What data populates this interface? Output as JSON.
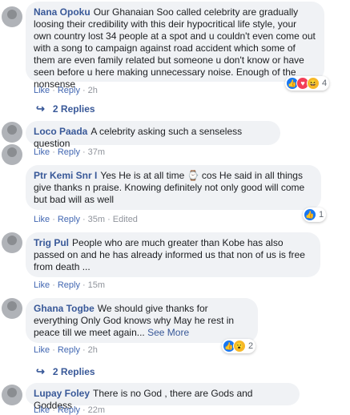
{
  "comments": [
    {
      "author": "Nana Opoku",
      "text": "Our Ghanaian Soo called celebrity are gradually loosing their credibility with this deir hypocritical life style, your own country lost 34 people at a spot and u couldn't even come out with a song to campaign against road accident which some of them are even family related but someone u don't know or have seen before u here making unnecessary noise. Enough of the nonsense",
      "like": "Like",
      "reply": "Reply",
      "time": "2h",
      "reaction_count": "4",
      "reaction_icons": [
        "like-icon",
        "love-icon",
        "haha-icon"
      ],
      "replies": "2 Replies"
    },
    {
      "author": "Loco Paada",
      "text": "A celebrity asking such a senseless question",
      "like": "Like",
      "reply": "Reply",
      "time": "37m"
    },
    {
      "author": "Ptr Kemi Snr I",
      "text": "Yes He is at all time ⌚ cos He said in all things give thanks n praise. Knowing definitely not only good will come but bad will as well",
      "like": "Like",
      "reply": "Reply",
      "time": "35m",
      "edited": "Edited",
      "reaction_count": "1",
      "reaction_icons": [
        "like-icon"
      ]
    },
    {
      "author": "Trig Pul",
      "text": "People who are much greater than Kobe has also passed on and he has already informed us that non of us is free from death ...",
      "like": "Like",
      "reply": "Reply",
      "time": "15m"
    },
    {
      "author": "Ghana Togbe",
      "text": "We should give thanks for everything Only God knows why May he rest in peace till we meet again...",
      "see_more": "See More",
      "like": "Like",
      "reply": "Reply",
      "time": "2h",
      "reaction_count": "2",
      "reaction_icons": [
        "like-icon",
        "wow-icon"
      ],
      "replies": "2 Replies"
    },
    {
      "author": "Lupay Foley",
      "text": "There is no God , there are Gods and Goddess .",
      "like": "Like",
      "reply": "Reply",
      "time": "22m"
    }
  ],
  "colors": {
    "author": "#385898",
    "bubble": "#f0f2f5",
    "link": "#4267b2",
    "meta": "#90949c"
  }
}
